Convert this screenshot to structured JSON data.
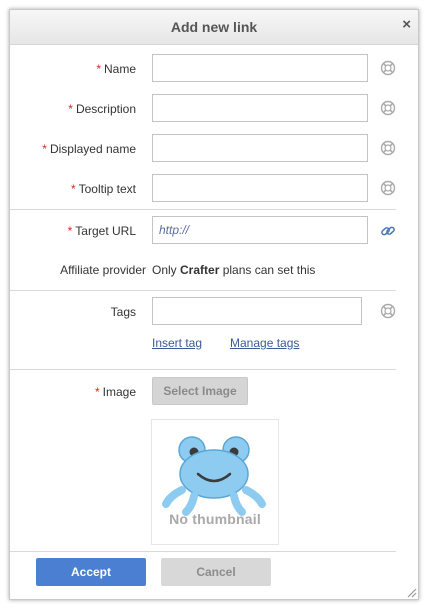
{
  "dialog": {
    "title": "Add new link",
    "close_glyph": "×"
  },
  "form": {
    "required_mark": "*",
    "name": {
      "label": "Name",
      "value": ""
    },
    "description": {
      "label": "Description",
      "value": ""
    },
    "displayed_name": {
      "label": "Displayed name",
      "value": ""
    },
    "tooltip_text": {
      "label": "Tooltip text",
      "value": ""
    },
    "target_url": {
      "label": "Target URL",
      "value": "http://"
    },
    "affiliate": {
      "label": "Affiliate provider",
      "prefix": "Only ",
      "plan": "Crafter",
      "suffix": " plans can set this"
    },
    "tags": {
      "label": "Tags",
      "value": "",
      "insert_tag": "Insert tag",
      "manage_tags": "Manage tags"
    },
    "image": {
      "label": "Image",
      "select_button": "Select Image",
      "thumbnail_text": "No thumbnail"
    }
  },
  "footer": {
    "accept": "Accept",
    "cancel": "Cancel"
  },
  "icons": {
    "help": "lifebuoy-icon",
    "link": "chain-link-icon",
    "placeholder": "frog-icon"
  },
  "colors": {
    "accept_bg": "#4a7fd1",
    "cancel_bg": "#d8d8d8",
    "select_bg": "#d5d5d5",
    "required": "#d9261c",
    "frog": "#8ecbf0"
  }
}
